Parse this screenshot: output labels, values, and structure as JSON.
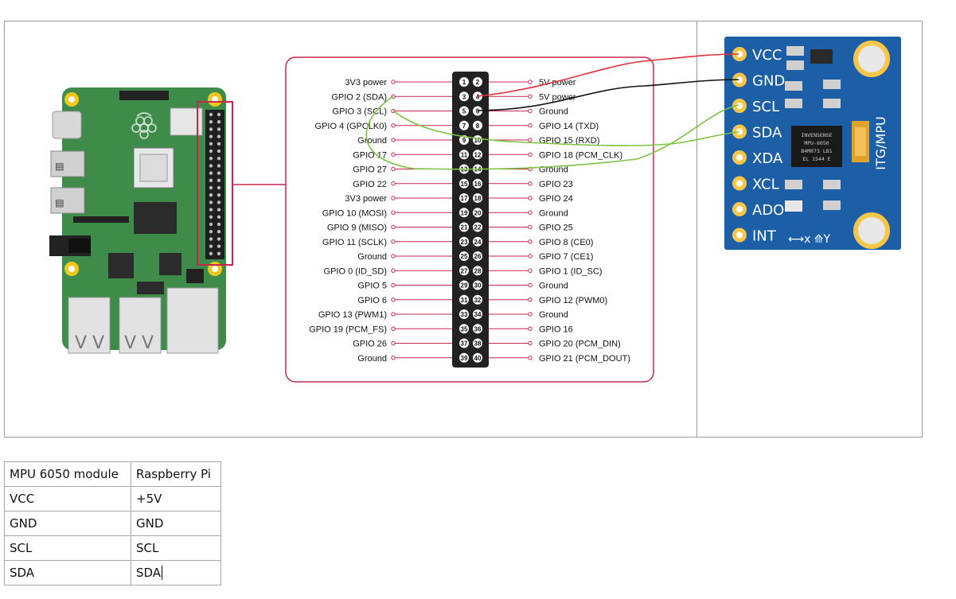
{
  "colors": {
    "board_green": "#3f8b4a",
    "highlight_border": "#c8274d",
    "wire_vcc": "#e0303a",
    "wire_gnd": "#111111",
    "wire_scl": "#7cc243",
    "wire_sda": "#7cc243",
    "module_blue": "#1d5fa6"
  },
  "header": {
    "left_labels": [
      "3V3 power",
      "GPIO 2 (SDA)",
      "GPIO 3 (SCL)",
      "GPIO 4 (GPCLK0)",
      "Ground",
      "GPIO 17",
      "GPIO 27",
      "GPIO 22",
      "3V3 power",
      "GPIO 10 (MOSI)",
      "GPIO 9 (MISO)",
      "GPIO 11 (SCLK)",
      "Ground",
      "GPIO 0 (ID_SD)",
      "GPIO 5",
      "GPIO 6",
      "GPIO 13 (PWM1)",
      "GPIO 19 (PCM_FS)",
      "GPIO 26",
      "Ground"
    ],
    "right_labels": [
      "5V power",
      "5V power",
      "Ground",
      "GPIO 14 (TXD)",
      "GPIO 15 (RXD)",
      "GPIO 18 (PCM_CLK)",
      "Ground",
      "GPIO 23",
      "GPIO 24",
      "Ground",
      "GPIO 25",
      "GPIO 8 (CE0)",
      "GPIO 7 (CE1)",
      "GPIO 1 (ID_SC)",
      "Ground",
      "GPIO 12 (PWM0)",
      "Ground",
      "GPIO 16",
      "GPIO 20 (PCM_DIN)",
      "GPIO 21 (PCM_DOUT)"
    ],
    "pin_numbers_left": [
      "1",
      "3",
      "5",
      "7",
      "9",
      "11",
      "13",
      "15",
      "17",
      "19",
      "21",
      "23",
      "25",
      "27",
      "29",
      "31",
      "33",
      "35",
      "37",
      "39"
    ],
    "pin_numbers_right": [
      "2",
      "4",
      "6",
      "8",
      "10",
      "12",
      "14",
      "16",
      "18",
      "20",
      "22",
      "24",
      "26",
      "28",
      "30",
      "32",
      "34",
      "36",
      "38",
      "40"
    ]
  },
  "module": {
    "pins": [
      "VCC",
      "GND",
      "SCL",
      "SDA",
      "XDA",
      "XCL",
      "ADO",
      "INT"
    ],
    "side_label": "ITG/MPU",
    "chip_lines": [
      "INVENSENSE",
      "MPU-6050",
      "B4M073 LB1",
      "EL 1544 E"
    ]
  },
  "table": {
    "rows": [
      [
        "MPU 6050 module",
        "Raspberry Pi"
      ],
      [
        "VCC",
        "+5V"
      ],
      [
        "GND",
        "GND"
      ],
      [
        "SCL",
        "SCL"
      ],
      [
        "SDA",
        "SDA"
      ]
    ]
  }
}
